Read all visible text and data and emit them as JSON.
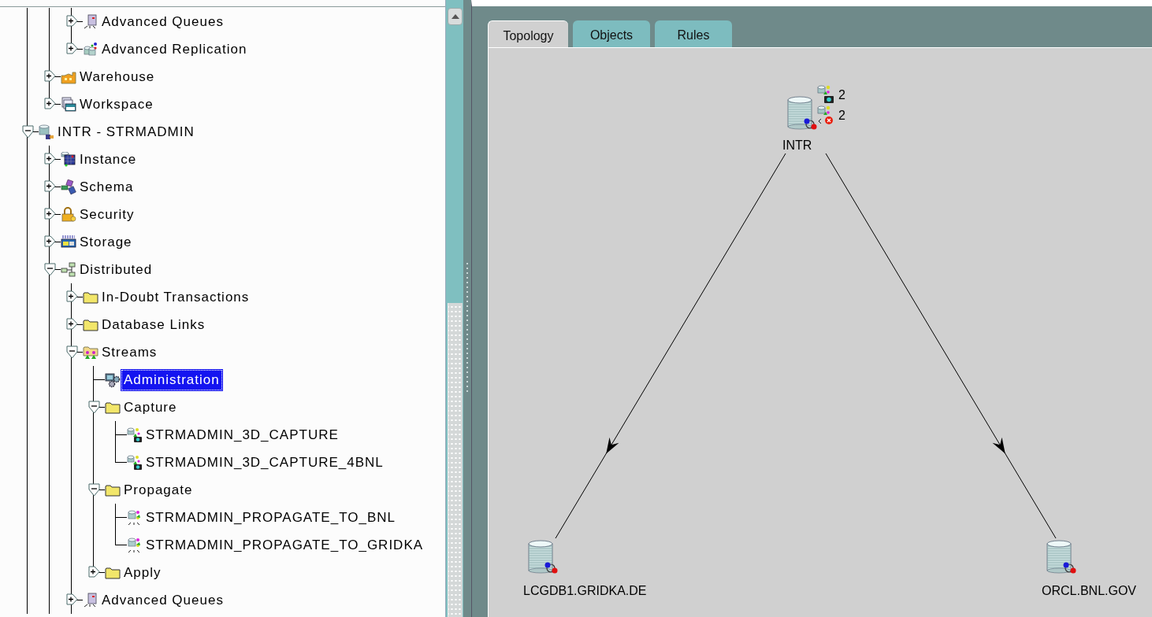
{
  "tree": {
    "items": [
      {
        "children": [
          {
            "children": [
              {
                "label": "Advanced Queues",
                "kind": "queue",
                "expanded": false,
                "selected": false
              },
              {
                "label": "Advanced Replication",
                "kind": "replication",
                "expanded": false,
                "selected": false
              }
            ]
          },
          {
            "label": "Warehouse",
            "kind": "warehouse",
            "expanded": false,
            "selected": false
          },
          {
            "label": "Workspace",
            "kind": "workspace",
            "expanded": false,
            "selected": false
          }
        ]
      },
      {
        "label": "INTR - STRMADMIN",
        "kind": "database",
        "expanded": true,
        "selected": false,
        "children": [
          {
            "label": "Instance",
            "kind": "instance",
            "expanded": false,
            "selected": false
          },
          {
            "label": "Schema",
            "kind": "schema",
            "expanded": false,
            "selected": false
          },
          {
            "label": "Security",
            "kind": "security",
            "expanded": false,
            "selected": false
          },
          {
            "label": "Storage",
            "kind": "storage",
            "expanded": false,
            "selected": false
          },
          {
            "label": "Distributed",
            "kind": "distributed",
            "expanded": true,
            "selected": false,
            "children": [
              {
                "label": "In-Doubt Transactions",
                "kind": "folder",
                "expanded": false,
                "selected": false
              },
              {
                "label": "Database Links",
                "kind": "folder",
                "expanded": false,
                "selected": false
              },
              {
                "label": "Streams",
                "kind": "streams",
                "expanded": true,
                "selected": false,
                "children": [
                  {
                    "label": "Administration",
                    "kind": "administration",
                    "selected": true
                  },
                  {
                    "label": "Capture",
                    "kind": "folder",
                    "expanded": true,
                    "selected": false,
                    "children": [
                      {
                        "label": "STRMADMIN_3D_CAPTURE",
                        "kind": "capture",
                        "selected": false
                      },
                      {
                        "label": "STRMADMIN_3D_CAPTURE_4BNL",
                        "kind": "capture",
                        "selected": false
                      }
                    ]
                  },
                  {
                    "label": "Propagate",
                    "kind": "folder",
                    "expanded": true,
                    "selected": false,
                    "children": [
                      {
                        "label": "STRMADMIN_PROPAGATE_TO_BNL",
                        "kind": "propagation",
                        "selected": false
                      },
                      {
                        "label": "STRMADMIN_PROPAGATE_TO_GRIDKA",
                        "kind": "propagation",
                        "selected": false
                      }
                    ]
                  },
                  {
                    "label": "Apply",
                    "kind": "folder",
                    "expanded": false,
                    "selected": false
                  }
                ]
              },
              {
                "label": "Advanced Queues",
                "kind": "queue",
                "expanded": false,
                "selected": false
              }
            ]
          }
        ]
      }
    ]
  },
  "tabs": [
    {
      "label": "Topology",
      "selected": true
    },
    {
      "label": "Objects",
      "selected": false
    },
    {
      "label": "Rules",
      "selected": false
    }
  ],
  "topology": {
    "nodes": [
      {
        "label": "INTR",
        "badges": [
          {
            "kind": "capture",
            "count": "2"
          },
          {
            "kind": "apply",
            "count": "2"
          }
        ],
        "children": [
          {
            "label": "LCGDB1.GRIDKA.DE"
          },
          {
            "label": "ORCL.BNL.GOV"
          }
        ]
      }
    ]
  }
}
